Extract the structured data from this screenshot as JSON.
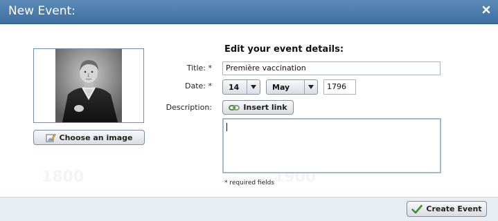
{
  "dialog": {
    "title": "New Event:",
    "close_icon": "close-icon"
  },
  "image_panel": {
    "image": "engraved portrait of a man",
    "choose_button_label": "Choose an image",
    "choose_icon": "edit-image-icon"
  },
  "form": {
    "heading": "Edit your event details:",
    "title_label": "Title: *",
    "title_value": "Première vaccination",
    "date_label": "Date: *",
    "day_value": "14",
    "month_value": "May",
    "year_value": "1796",
    "description_label": "Description:",
    "insert_link_label": "Insert link",
    "insert_link_icon": "link-icon",
    "description_value": "",
    "required_note": "* required fields"
  },
  "footer": {
    "create_button_label": "Create Event",
    "create_icon": "checkmark-icon"
  },
  "background_watermark": {
    "left_year": "1800",
    "right_year": "1900"
  }
}
